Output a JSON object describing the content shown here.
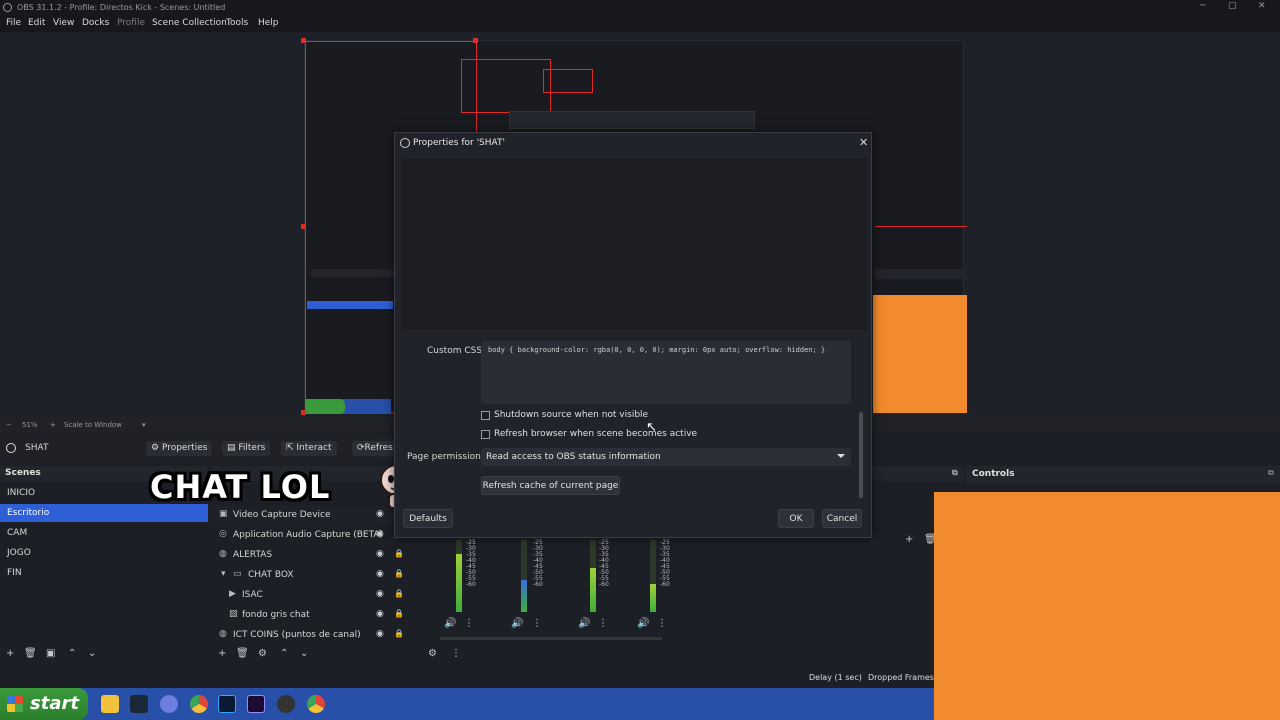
{
  "window": {
    "title": "OBS 31.1.2 - Profile: Directos Kick - Scenes: Untitled"
  },
  "menu": [
    "File",
    "Edit",
    "View",
    "Docks",
    "Profile",
    "Scene Collection",
    "Tools",
    "Help"
  ],
  "zoom": {
    "percent": "51%",
    "mode": "Scale to Window"
  },
  "source_toolbar": {
    "source_name": "SHAT",
    "properties": "Properties",
    "filters": "Filters",
    "interact": "Interact",
    "refresh": "Refres"
  },
  "scenes": {
    "title": "Scenes",
    "items": [
      "INICIO",
      "Escritorio",
      "CAM",
      "JOGO",
      "FIN"
    ],
    "selected": "Escritorio"
  },
  "sources": {
    "items": [
      {
        "name": "Video Capture Device",
        "icon": "camera-icon"
      },
      {
        "name": "Application Audio Capture (BETA)",
        "icon": "audio-icon"
      },
      {
        "name": "ALERTAS",
        "icon": "globe-icon"
      },
      {
        "name": "CHAT BOX",
        "icon": "folder-icon"
      },
      {
        "name": "ISAC",
        "icon": "play-icon"
      },
      {
        "name": "fondo gris chat",
        "icon": "image-icon"
      },
      {
        "name": "ICT COINS (puntos de canal)",
        "icon": "globe-icon"
      }
    ]
  },
  "mixer": {
    "scale": "-25\n-30\n-35\n-40\n-45\n-50\n-55\n-60"
  },
  "controls": {
    "title": "Controls"
  },
  "status": {
    "delay": "Delay (1 sec)",
    "dropped": "Dropped Frames"
  },
  "overlay": {
    "text": "CHAT LOL"
  },
  "taskbar": {
    "start": "start"
  },
  "dialog": {
    "title": "Properties for 'SHAT'",
    "custom_css_label": "Custom CSS",
    "custom_css_value": "body { background-color: rgba(0, 0, 0, 0); margin: 0px auto; overflow: hidden; }",
    "shutdown_label": "Shutdown source when not visible",
    "refresh_active_label": "Refresh browser when scene becomes active",
    "page_permissions_label": "Page permissions",
    "page_permissions_value": "Read access to OBS status information",
    "refresh_cache_label": "Refresh cache of current page",
    "defaults_label": "Defaults",
    "ok_label": "OK",
    "cancel_label": "Cancel"
  },
  "colors": {
    "accent": "#2f5fd6",
    "orange": "#f28a2e",
    "selection_red": "#e02a2a"
  }
}
